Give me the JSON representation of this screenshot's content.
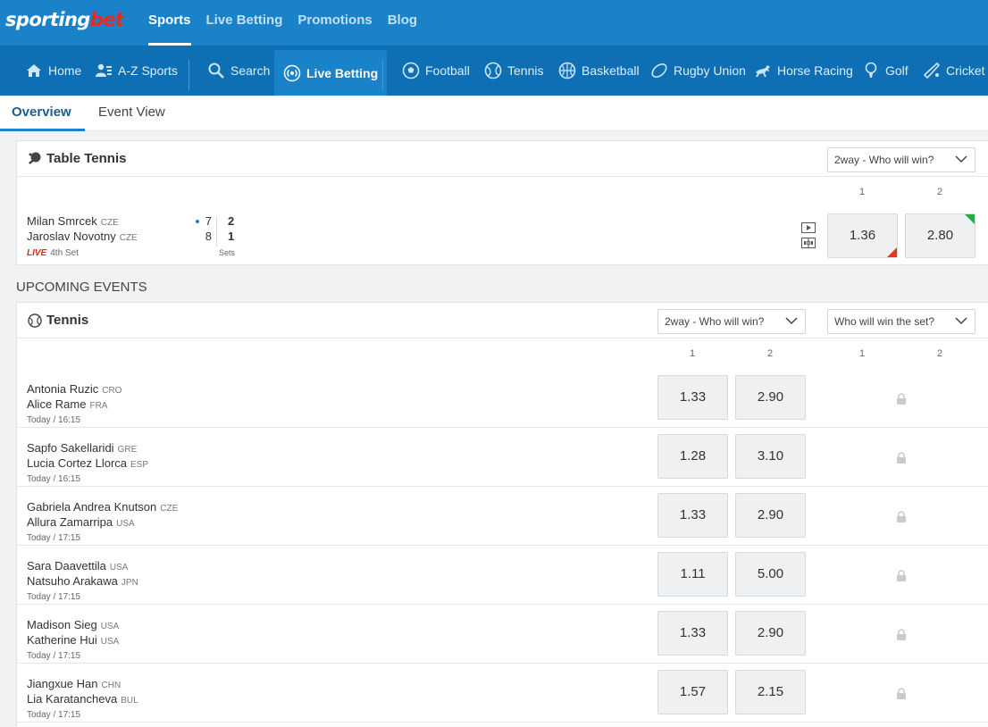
{
  "brand": {
    "part1": "sporting",
    "part2": "bet"
  },
  "top_nav": [
    "Sports",
    "Live Betting",
    "Promotions",
    "Blog"
  ],
  "sports_nav": {
    "home": "Home",
    "az": "A-Z Sports",
    "search": "Search",
    "live": "Live Betting",
    "football": "Football",
    "tennis": "Tennis",
    "basketball": "Basketball",
    "rugby": "Rugby Union",
    "horse": "Horse Racing",
    "golf": "Golf",
    "cricket": "Cricket"
  },
  "sub_tabs": [
    "Overview",
    "Event View"
  ],
  "live_section": {
    "title": "Table Tennis",
    "market": "2way - Who will win?",
    "col1": "1",
    "col2": "2",
    "match": {
      "p1": "Milan Smrcek",
      "p1_cc": "CZE",
      "p2": "Jaroslav Novotny",
      "p2_cc": "CZE",
      "live_label": "LIVE",
      "period": "4th Set",
      "p1_points": "7",
      "p2_points": "8",
      "p1_sets": "2",
      "p2_sets": "1",
      "sets_label": "Sets",
      "odd1": "1.36",
      "odd2": "2.80"
    }
  },
  "upcoming_label": "UPCOMING EVENTS",
  "upcoming_section": {
    "title": "Tennis",
    "market1": "2way - Who will win?",
    "market2": "Who will win the set?",
    "cols": [
      "1",
      "2",
      "1",
      "2"
    ],
    "events": [
      {
        "p1": "Antonia Ruzic",
        "p1_cc": "CRO",
        "p2": "Alice Rame",
        "p2_cc": "FRA",
        "time": "Today / 16:15",
        "odd1": "1.33",
        "odd2": "2.90"
      },
      {
        "p1": "Sapfo Sakellaridi",
        "p1_cc": "GRE",
        "p2": "Lucia Cortez Llorca",
        "p2_cc": "ESP",
        "time": "Today / 16:15",
        "odd1": "1.28",
        "odd2": "3.10"
      },
      {
        "p1": "Gabriela Andrea Knutson",
        "p1_cc": "CZE",
        "p2": "Allura Zamarripa",
        "p2_cc": "USA",
        "time": "Today / 17:15",
        "odd1": "1.33",
        "odd2": "2.90"
      },
      {
        "p1": "Sara Daavettila",
        "p1_cc": "USA",
        "p2": "Natsuho Arakawa",
        "p2_cc": "JPN",
        "time": "Today / 17:15",
        "odd1": "1.11",
        "odd2": "5.00"
      },
      {
        "p1": "Madison Sieg",
        "p1_cc": "USA",
        "p2": "Katherine Hui",
        "p2_cc": "USA",
        "time": "Today / 17:15",
        "odd1": "1.33",
        "odd2": "2.90"
      },
      {
        "p1": "Jiangxue Han",
        "p1_cc": "CHN",
        "p2": "Lia Karatancheva",
        "p2_cc": "BUL",
        "time": "Today / 17:15",
        "odd1": "1.57",
        "odd2": "2.15"
      }
    ]
  },
  "colors": {
    "brand_blue": "#1a82c9",
    "nav_blue": "#0e6fb4",
    "live_red": "#e2231a",
    "odds_up": "#2aa84a",
    "odds_down": "#e8361f"
  }
}
